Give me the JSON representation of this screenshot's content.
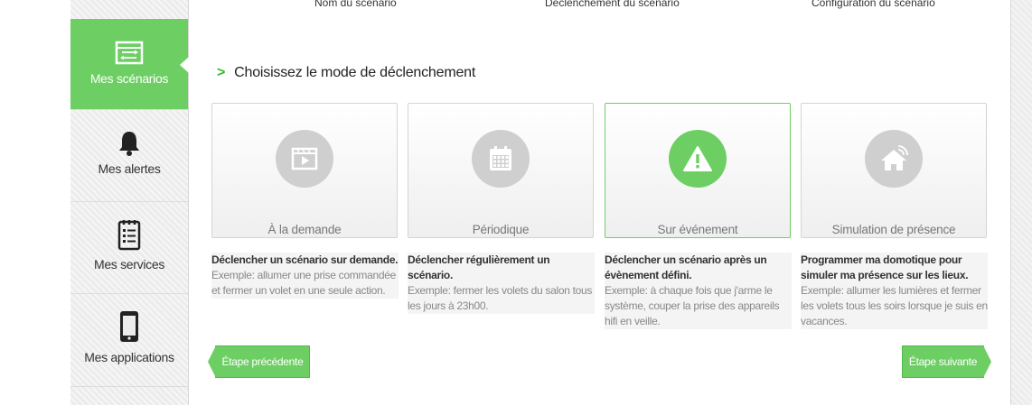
{
  "wizard_steps": [
    "Nom du scénario",
    "Déclenchement du scénario",
    "Configuration du scénario"
  ],
  "sidebar": {
    "items": [
      {
        "label": "Mes scénarios",
        "icon": "scenarios-icon",
        "active": true
      },
      {
        "label": "Mes alertes",
        "icon": "bell-icon",
        "active": false
      },
      {
        "label": "Mes services",
        "icon": "checklist-icon",
        "active": false
      },
      {
        "label": "Mes applications",
        "icon": "smartphone-icon",
        "active": false
      }
    ]
  },
  "main": {
    "heading": "Choisissez le mode de déclenchement",
    "modes": [
      {
        "label": "À la demande",
        "icon": "video-play-icon",
        "selected": false,
        "title": "Déclencher un scénario sur demande.",
        "example": "Exemple: allumer une prise commandée et fermer un volet en une seule action."
      },
      {
        "label": "Périodique",
        "icon": "calendar-icon",
        "selected": false,
        "title": "Déclencher régulièrement un scénario.",
        "example": "Exemple: fermer les volets du salon tous les jours à 23h00."
      },
      {
        "label": "Sur événement",
        "icon": "warning-icon",
        "selected": true,
        "title": "Déclencher un scénario après un évènement défini.",
        "example": "Exemple: à chaque fois que j'arme le système, couper la prise des appareils hifi en veille."
      },
      {
        "label": "Simulation de présence",
        "icon": "home-wifi-icon",
        "selected": false,
        "title": "Programmer ma domotique pour simuler ma présence sur les lieux.",
        "example": "Exemple: allumer les lumières et fermer les volets tous les soirs lorsque je suis en vacances."
      }
    ],
    "prev_label": "Étape précédente",
    "next_label": "Étape suivante"
  },
  "colors": {
    "accent": "#6dcf63",
    "inactive_circle": "#cfcfcf",
    "chevron": "#35b82c"
  }
}
